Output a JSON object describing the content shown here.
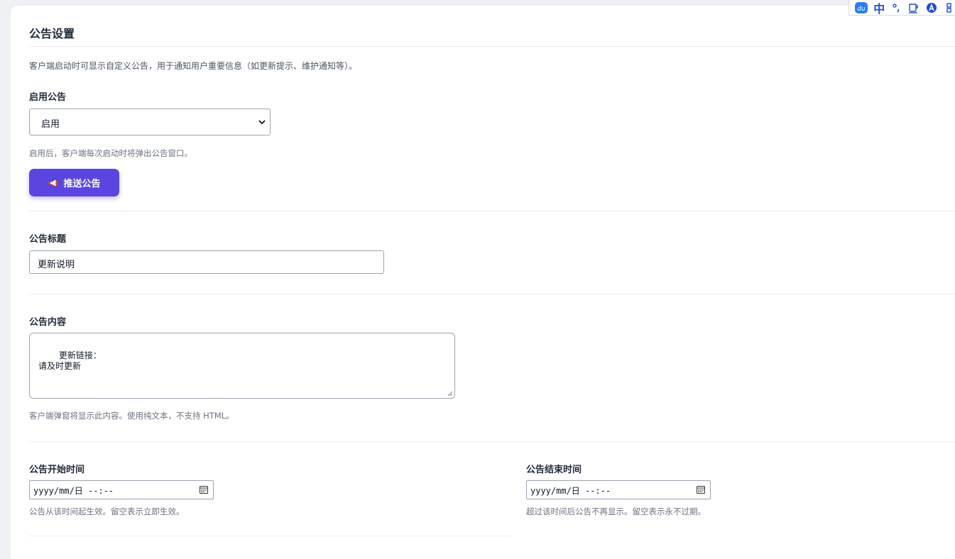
{
  "page": {
    "title": "公告设置",
    "description": "客户端启动时可显示自定义公告，用于通知用户重要信息（如更新提示、维护通知等）。"
  },
  "enable": {
    "label": "启用公告",
    "selected": "启用",
    "hint": "启用后，客户端每次启动时将弹出公告窗口。"
  },
  "push_button": {
    "label": "推送公告",
    "icon": "megaphone-icon"
  },
  "title_field": {
    "label": "公告标题",
    "value": "更新说明"
  },
  "content_field": {
    "label": "公告内容",
    "value": "更新链接：\n请及时更新",
    "hint": "客户端弹窗将显示此内容。使用纯文本，不支持 HTML。"
  },
  "start_time": {
    "label": "公告开始时间",
    "placeholder": "yyyy/mm/日 --:--",
    "hint": "公告从该时间起生效。留空表示立即生效。"
  },
  "end_time": {
    "label": "公告结束时间",
    "placeholder": "yyyy/mm/日 --:--",
    "hint": "超过该时间后公告不再显示。留空表示永不过期。"
  },
  "ime_toolbar": {
    "language": "中",
    "icons": [
      "baidu-du-icon",
      "punctuation-icon",
      "cup-icon",
      "skin-icon",
      "grid-icon"
    ]
  },
  "colors": {
    "accent": "#5b45e0",
    "ime_blue": "#1d4ed8"
  }
}
